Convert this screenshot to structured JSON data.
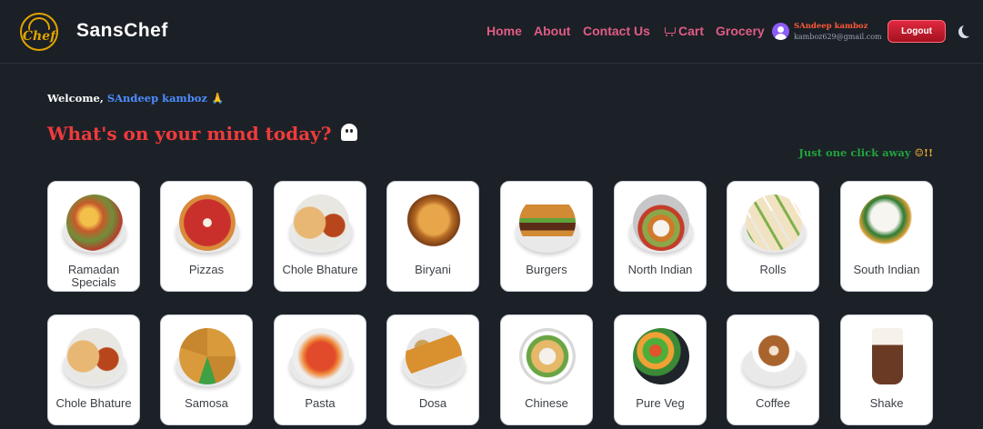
{
  "brand": {
    "name": "SansChef",
    "logo_text": "Chef"
  },
  "nav": {
    "home": "Home",
    "about": "About",
    "contact": "Contact Us",
    "cart": "Cart",
    "grocery": "Grocery"
  },
  "user": {
    "name": "SAndeep kamboz",
    "email": "kamboz629@gmail.com"
  },
  "logout_label": "Logout",
  "theme_icon": "moon-icon",
  "welcome": {
    "prefix": "Welcome,",
    "name": "SAndeep kamboz",
    "emoji": "🙏"
  },
  "headline": "What's on your mind today?",
  "tagline": {
    "text": "Just one click away",
    "emoji": "☺",
    "suffix": "!!"
  },
  "categories_row1": [
    "Ramadan Specials",
    "Pizzas",
    "Chole Bhature",
    "Biryani",
    "Burgers",
    "North Indian",
    "Rolls",
    "South Indian"
  ],
  "categories_row2": [
    "Chole Bhature",
    "Samosa",
    "Pasta",
    "Dosa",
    "Chinese",
    "Pure Veg",
    "Coffee",
    "Shake"
  ],
  "colors": {
    "background": "#1c2128",
    "nav_link": "#e05c84",
    "headline": "#ef3b3b",
    "tagline": "#21a33e",
    "user_name": "#ff5a36",
    "logout": "#d11f33"
  }
}
